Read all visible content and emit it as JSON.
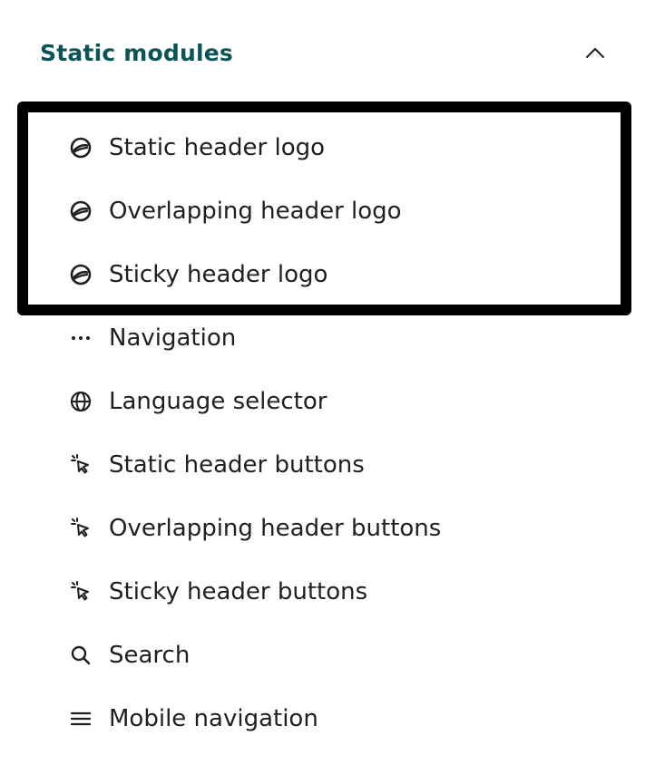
{
  "section": {
    "title": "Static modules",
    "expanded": true
  },
  "modules": [
    {
      "label": "Static header logo",
      "icon": "logo-icon"
    },
    {
      "label": "Overlapping header logo",
      "icon": "logo-icon"
    },
    {
      "label": "Sticky header logo",
      "icon": "logo-icon"
    },
    {
      "label": "Navigation",
      "icon": "more-dots-icon"
    },
    {
      "label": "Language selector",
      "icon": "globe-icon"
    },
    {
      "label": "Static header buttons",
      "icon": "cursor-click-icon"
    },
    {
      "label": "Overlapping header buttons",
      "icon": "cursor-click-icon"
    },
    {
      "label": "Sticky header buttons",
      "icon": "cursor-click-icon"
    },
    {
      "label": "Search",
      "icon": "search-icon"
    },
    {
      "label": "Mobile navigation",
      "icon": "menu-icon"
    }
  ],
  "colors": {
    "title": "#0b5455",
    "text": "#1f1f1f",
    "highlight_border": "#000000"
  }
}
